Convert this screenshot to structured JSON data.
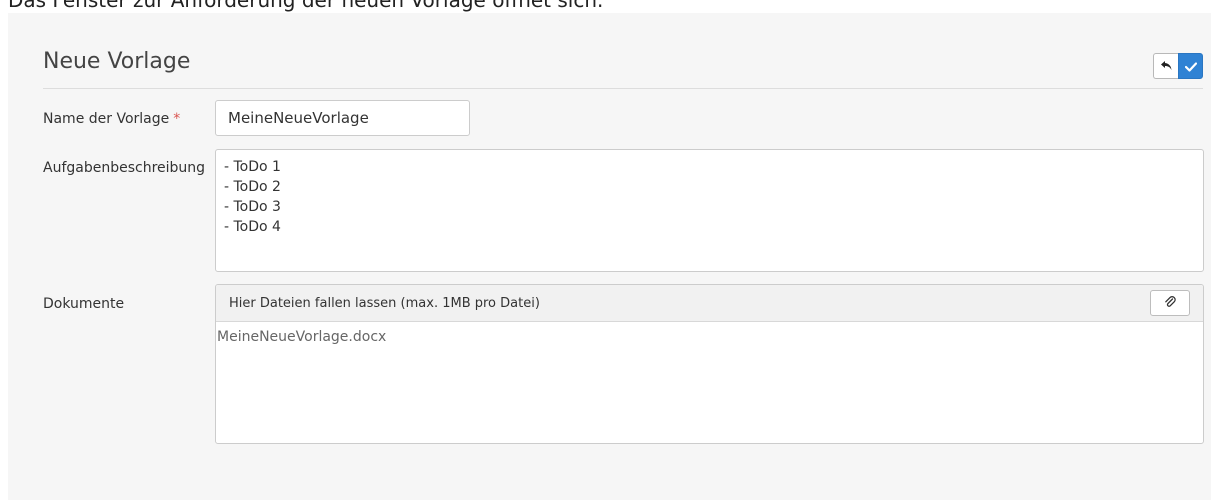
{
  "caption": "Das Fenster zur Anforderung der neuen Vorlage öffnet sich.",
  "form": {
    "title": "Neue Vorlage",
    "buttons": {
      "back_icon": "undo-arrow-icon",
      "ok_icon": "check-icon"
    },
    "name_field": {
      "label": "Name der Vorlage",
      "required_marker": "*",
      "value": "MeineNeueVorlage"
    },
    "description_field": {
      "label": "Aufgabenbeschreibung",
      "lines": [
        "- ToDo 1",
        "- ToDo 2",
        "- ToDo 3",
        "- ToDo 4"
      ]
    },
    "documents_field": {
      "label": "Dokumente",
      "dropzone_hint": "Hier Dateien fallen lassen (max. 1MB pro Datei)",
      "attach_icon": "paperclip-icon",
      "files": [
        "MeineNeueVorlage.docx"
      ]
    }
  },
  "colors": {
    "primary": "#2f82d4",
    "required": "#d9534f",
    "panel_background": "#f6f6f6"
  }
}
